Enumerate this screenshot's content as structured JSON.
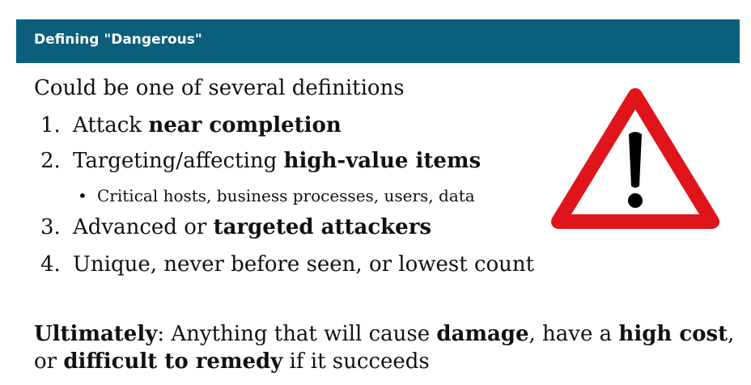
{
  "header": {
    "title": "Defining \"Dangerous\""
  },
  "body": {
    "intro": "Could be one of several definitions",
    "items": [
      {
        "number": "1.",
        "prefix": "Attack ",
        "emphasis": "near completion",
        "suffix": ""
      },
      {
        "number": "2.",
        "prefix": "Targeting/affecting ",
        "emphasis": "high-value items",
        "suffix": ""
      },
      {
        "number": "3.",
        "prefix": "Advanced or ",
        "emphasis": "targeted attackers",
        "suffix": ""
      },
      {
        "number": "4.",
        "prefix": "Unique, never before seen, or lowest count",
        "emphasis": "",
        "suffix": ""
      }
    ],
    "subitem": {
      "bullet": "•",
      "text": "Critical hosts, business processes, users, data"
    },
    "ultimately": {
      "label": "Ultimately",
      "part1": ": Anything that will cause ",
      "bold1": "damage",
      "part2": ", have a ",
      "bold2": "high cost",
      "part3": ",",
      "part4": "or ",
      "bold3": "difficult to remedy",
      "part5": " if it succeeds"
    }
  },
  "graphic": {
    "icon": "warning-triangle-icon",
    "border_color": "#e0151b",
    "fill_color": "#ffffff",
    "mark_color": "#000000"
  },
  "colors": {
    "title_bar": "#0b5f7a",
    "title_text": "#ffffff"
  }
}
